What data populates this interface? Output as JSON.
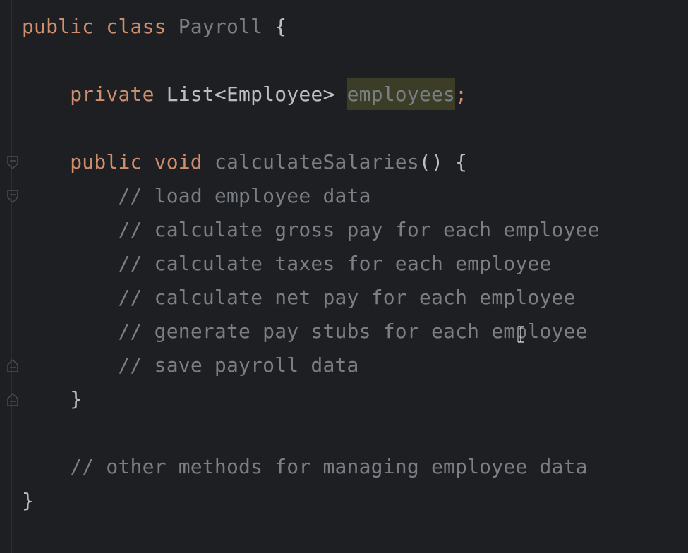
{
  "editor": {
    "lines": [
      {
        "tokens": [
          {
            "text": "public class ",
            "style": "kw"
          },
          {
            "text": "Payroll",
            "style": "fn"
          },
          {
            "text": " {",
            "style": "plain"
          }
        ]
      },
      {
        "tokens": []
      },
      {
        "tokens": [
          {
            "text": "    "
          },
          {
            "text": "private ",
            "style": "kw"
          },
          {
            "text": "List<Employee> ",
            "style": "plain"
          },
          {
            "text": "employees",
            "style": "sel"
          },
          {
            "text": ";",
            "style": "kw"
          }
        ]
      },
      {
        "tokens": []
      },
      {
        "tokens": [
          {
            "text": "    "
          },
          {
            "text": "public void ",
            "style": "kw"
          },
          {
            "text": "calculateSalaries",
            "style": "fn"
          },
          {
            "text": "() {",
            "style": "plain"
          }
        ]
      },
      {
        "tokens": [
          {
            "text": "        "
          },
          {
            "text": "// load employee data",
            "style": "cm"
          }
        ]
      },
      {
        "tokens": [
          {
            "text": "        "
          },
          {
            "text": "// calculate gross pay for each employee",
            "style": "cm"
          }
        ]
      },
      {
        "tokens": [
          {
            "text": "        "
          },
          {
            "text": "// calculate taxes for each employee",
            "style": "cm"
          }
        ]
      },
      {
        "tokens": [
          {
            "text": "        "
          },
          {
            "text": "// calculate net pay for each employee",
            "style": "cm"
          }
        ]
      },
      {
        "tokens": [
          {
            "text": "        "
          },
          {
            "text": "// generate pay stubs for each employee",
            "style": "cm"
          }
        ]
      },
      {
        "tokens": [
          {
            "text": "        "
          },
          {
            "text": "// save payroll data",
            "style": "cm"
          }
        ]
      },
      {
        "tokens": [
          {
            "text": "    "
          },
          {
            "text": "}",
            "style": "plain"
          }
        ]
      },
      {
        "tokens": []
      },
      {
        "tokens": [
          {
            "text": "    "
          },
          {
            "text": "// other methods for managing employee data",
            "style": "cm"
          }
        ]
      },
      {
        "tokens": [
          {
            "text": "}",
            "style": "plain"
          }
        ]
      }
    ]
  },
  "colors": {
    "background": "#1e1f22",
    "keyword": "#cf8e6d",
    "text": "#bcbec4",
    "comment": "#7a7e85",
    "selection_highlight": "#3b3d26"
  },
  "icons": {
    "fold_open": "fold-marker-icon",
    "fold_close": "fold-end-marker-icon",
    "cursor": "text-cursor-icon"
  }
}
